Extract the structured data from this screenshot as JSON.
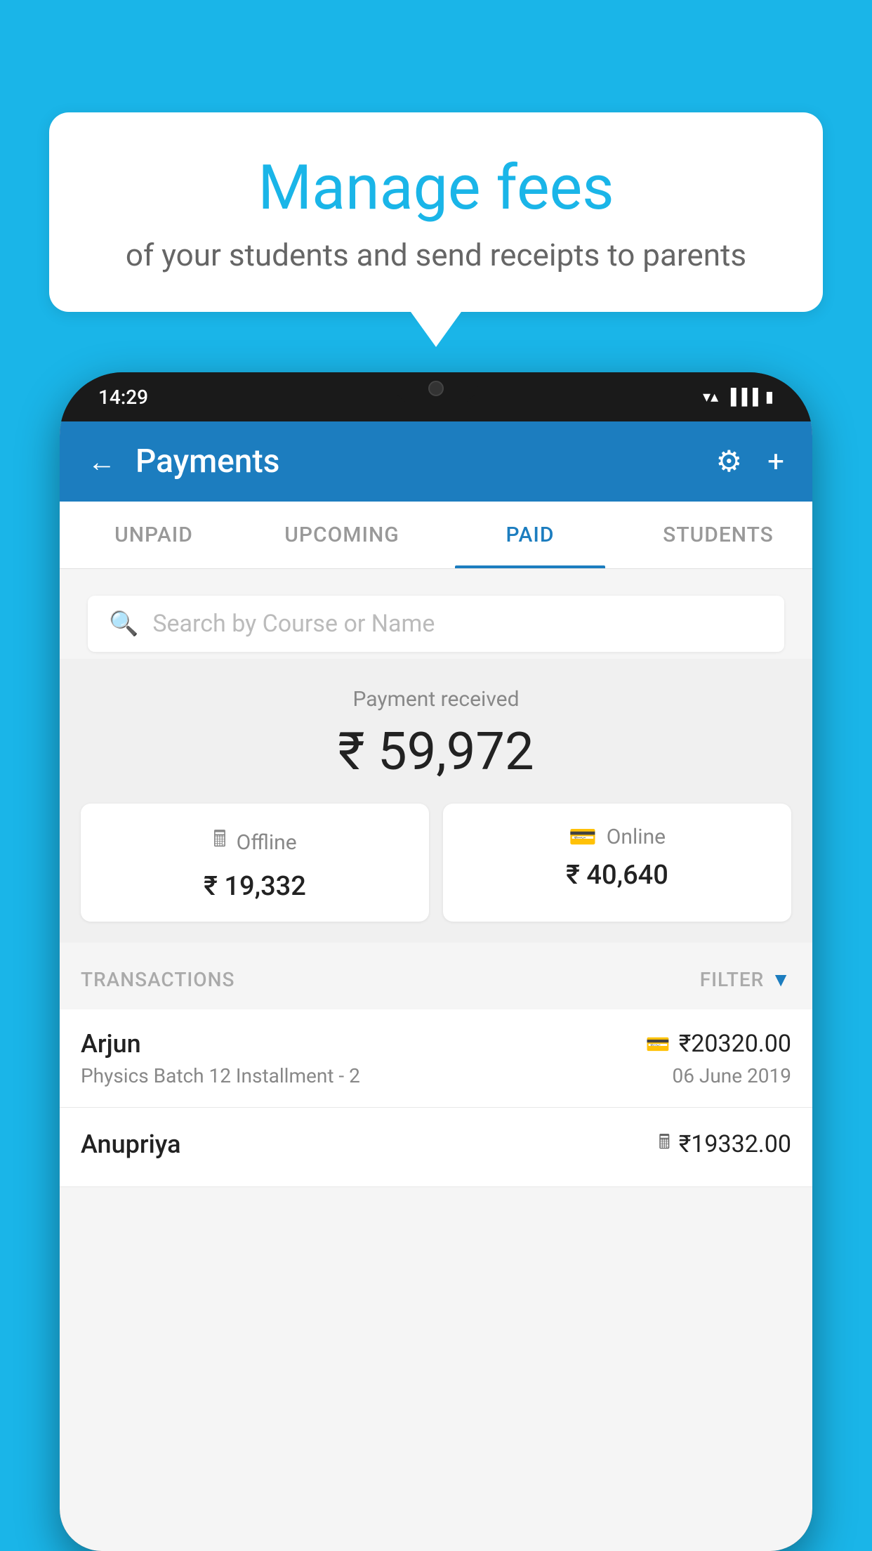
{
  "background": {
    "color": "#1ab5e8"
  },
  "speechBubble": {
    "title": "Manage fees",
    "subtitle": "of your students and send receipts to parents"
  },
  "statusBar": {
    "time": "14:29",
    "icons": [
      "wifi",
      "signal",
      "battery"
    ]
  },
  "header": {
    "title": "Payments",
    "backLabel": "←",
    "settingsLabel": "⚙",
    "addLabel": "+"
  },
  "tabs": [
    {
      "label": "UNPAID",
      "active": false
    },
    {
      "label": "UPCOMING",
      "active": false
    },
    {
      "label": "PAID",
      "active": true
    },
    {
      "label": "STUDENTS",
      "active": false
    }
  ],
  "search": {
    "placeholder": "Search by Course or Name"
  },
  "paymentSummary": {
    "label": "Payment received",
    "total": "₹ 59,972",
    "offline": {
      "label": "Offline",
      "amount": "₹ 19,332"
    },
    "online": {
      "label": "Online",
      "amount": "₹ 40,640"
    }
  },
  "transactions": {
    "sectionLabel": "TRANSACTIONS",
    "filterLabel": "FILTER",
    "rows": [
      {
        "name": "Arjun",
        "detail": "Physics Batch 12 Installment - 2",
        "amount": "₹20320.00",
        "date": "06 June 2019",
        "paymentType": "card"
      },
      {
        "name": "Anupriya",
        "detail": "",
        "amount": "₹19332.00",
        "date": "",
        "paymentType": "offline"
      }
    ]
  }
}
